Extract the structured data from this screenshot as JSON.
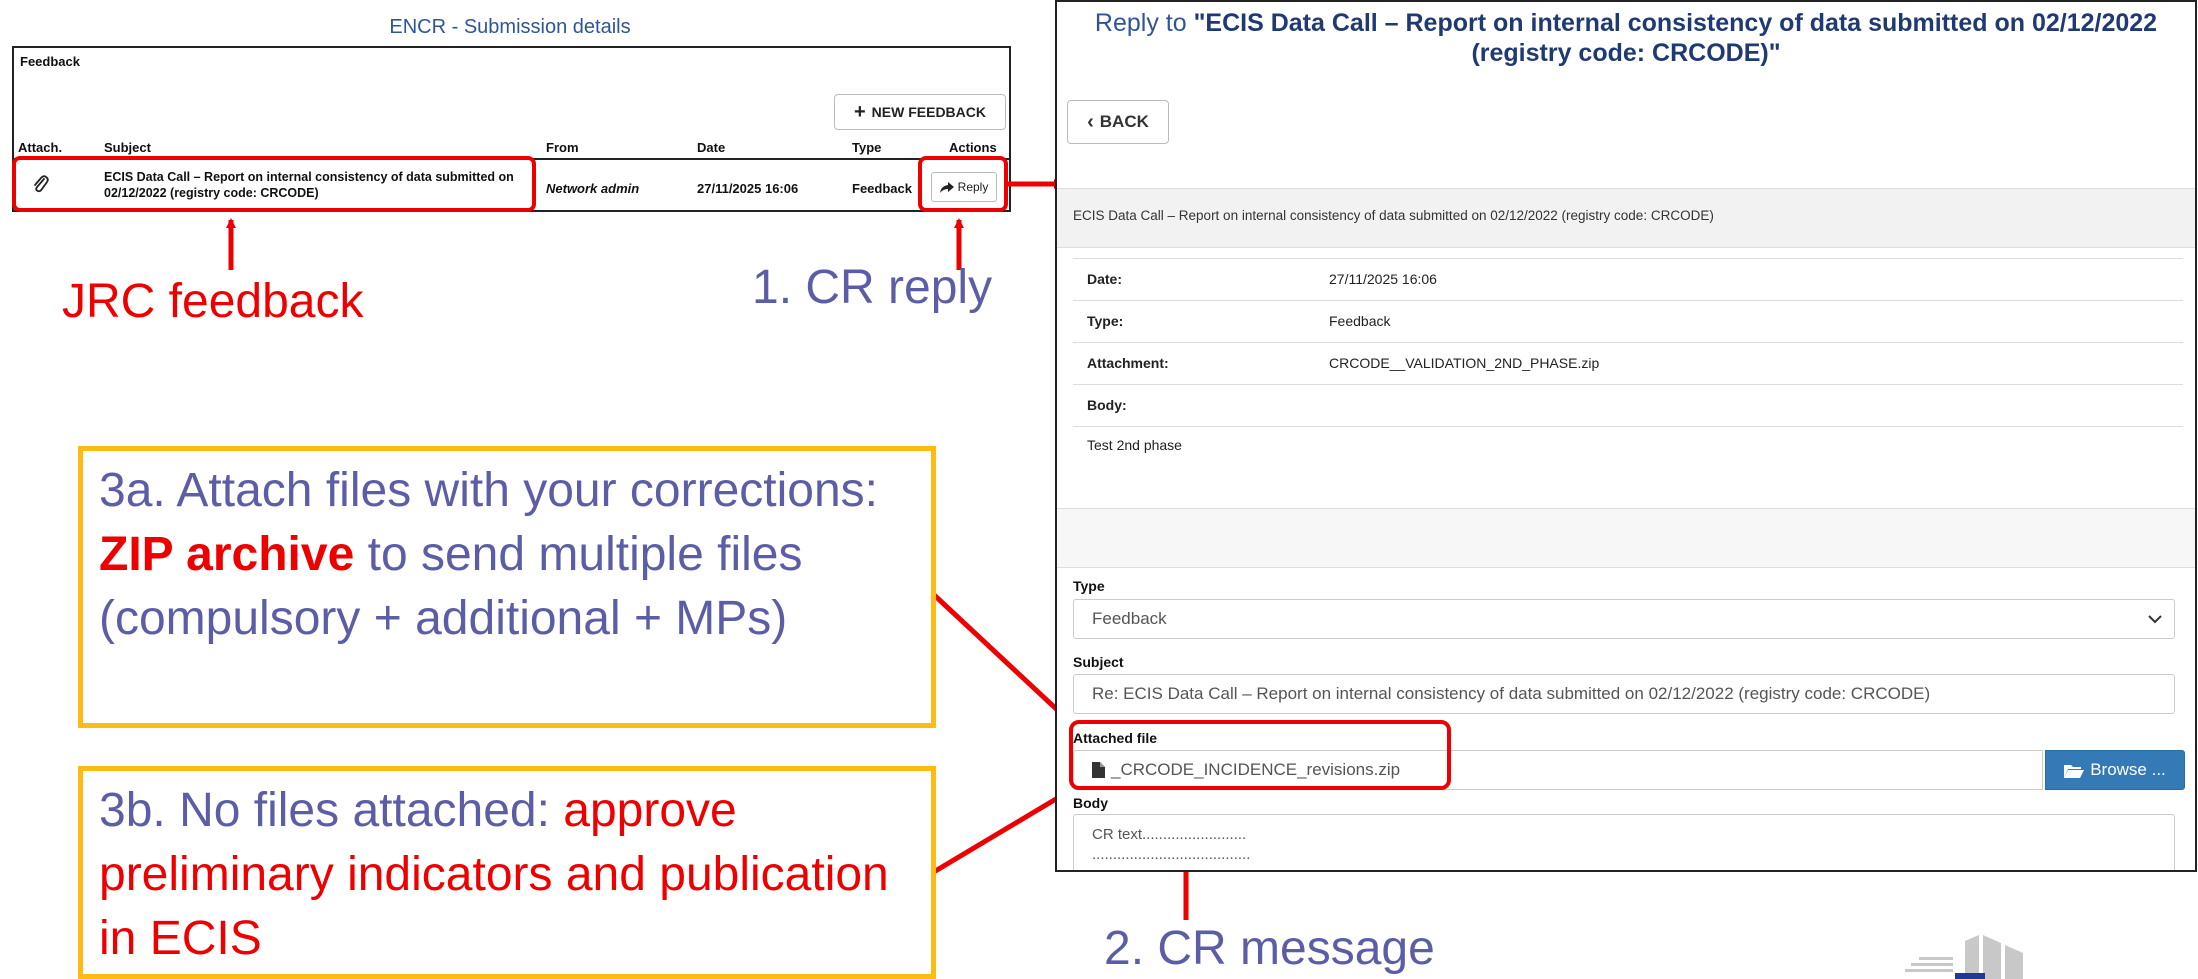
{
  "left_panel": {
    "title": "ENCR - Submission details",
    "feedback_label": "Feedback",
    "new_feedback_button": "NEW FEEDBACK",
    "columns": [
      "Attach.",
      "Subject",
      "From",
      "Date",
      "Type",
      "Actions"
    ],
    "row": {
      "subject": "ECIS Data Call – Report on internal consistency of data submitted on 02/12/2022 (registry code: CRCODE)",
      "from": "Network admin",
      "date": "27/11/2025 16:06",
      "type": "Feedback",
      "reply_button": "Reply"
    }
  },
  "callouts": {
    "jrc_feedback": "JRC feedback",
    "cr_reply": "1. CR reply",
    "cr_message": "2. CR message"
  },
  "box_3a": {
    "part1": "3a. Attach files with your corrections: ",
    "highlight": "ZIP archive",
    "part2": " to send multiple files (compulsory + additional + MPs)"
  },
  "box_3b": {
    "part1": "3b. No files attached: ",
    "highlight": "approve preliminary indicators and publication in ECIS"
  },
  "right_panel": {
    "title_prefix": "Reply to ",
    "title_bold": "\"ECIS Data Call – Report on internal consistency of data submitted on 02/12/2022 (registry code: CRCODE)\"",
    "back_button": "BACK",
    "subject_band": "ECIS Data Call – Report on internal consistency of data submitted on 02/12/2022 (registry code: CRCODE)",
    "meta": [
      {
        "label": "Date:",
        "value": "27/11/2025 16:06"
      },
      {
        "label": "Type:",
        "value": "Feedback"
      },
      {
        "label": "Attachment:",
        "value": "CRCODE__VALIDATION_2ND_PHASE.zip"
      },
      {
        "label": "Body:",
        "value": ""
      }
    ],
    "body_text": "Test 2nd phase",
    "form": {
      "type_label": "Type",
      "type_value": "Feedback",
      "subject_label": "Subject",
      "subject_value": "Re: ECIS Data Call – Report on internal consistency of data submitted on 02/12/2022 (registry code: CRCODE)",
      "attached_label": "Attached file",
      "attached_value": "_CRCODE_INCIDENCE_revisions.zip",
      "browse_button": "Browse ...",
      "body_label": "Body",
      "body_line1": "CR text.........................",
      "body_line2": "......................................"
    }
  },
  "colors": {
    "annotation_red": "#ee0000",
    "annotation_blue": "#5b5ea6",
    "box_yellow": "#fdbb14",
    "button_blue": "#337ab7"
  }
}
